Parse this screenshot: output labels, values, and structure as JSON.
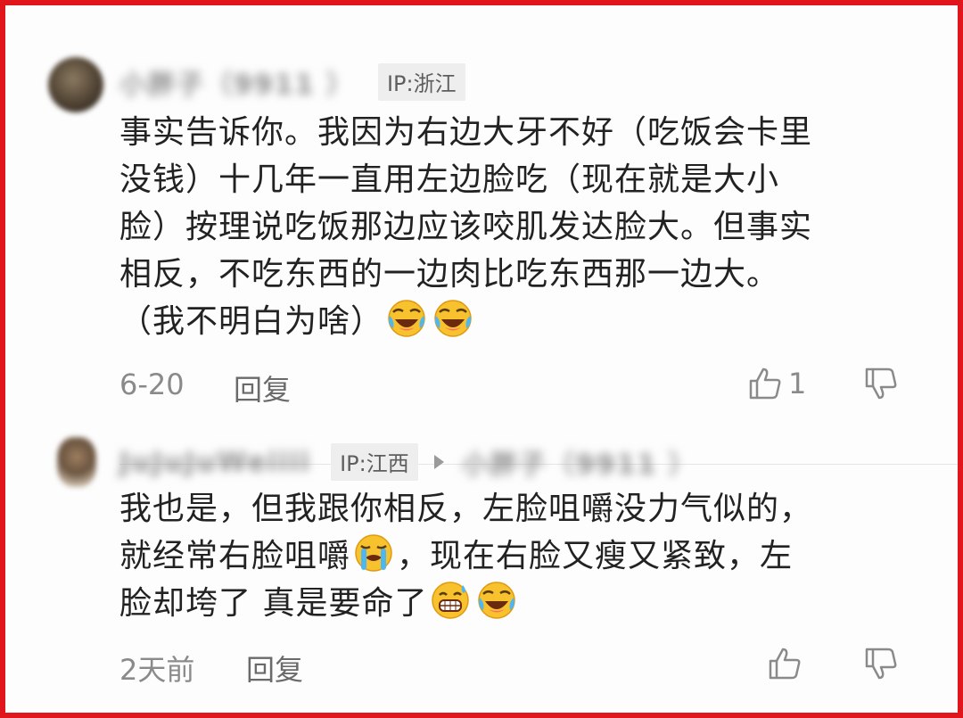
{
  "comments": [
    {
      "username": "小胖子（9911 ）",
      "ip": "IP:浙江",
      "lines": [
        "事实告诉你。我因为右边大牙不好（吃饭会卡里",
        "没钱）十几年一直用左边脸吃（现在就是大小",
        "脸）按理说吃饭那边应该咬肌发达脸大。但事实",
        "相反，不吃东西的一边肉比吃东西那一边大。",
        "（我不明白为啥）"
      ],
      "date": "6-20",
      "reply_label": "回复",
      "likes": "1"
    },
    {
      "username": "JuJuJuWeiiii",
      "ip": "IP:江西",
      "reply_to": "小胖子（9911 ）",
      "line1": "我也是，但我跟你相反，左脸咀嚼没力气似的，",
      "line2a": "就经常右脸咀嚼",
      "line2b": "，现在右脸又瘦又紧致，左",
      "line3": "脸却垮了 真是要命了",
      "date": "2天前",
      "reply_label": "回复"
    }
  ],
  "icons": {
    "thumb_up": "thumbs-up-icon",
    "thumb_down": "thumbs-down-icon",
    "emoji_laugh_cry": "rolling-on-floor-laughing-icon",
    "emoji_cry": "crying-face-icon",
    "emoji_grin_sweat": "grinning-sweat-icon"
  },
  "colors": {
    "border": "#e0161c",
    "text": "#222222",
    "meta": "#8a8a8a",
    "badge_bg": "#eeeeee"
  }
}
